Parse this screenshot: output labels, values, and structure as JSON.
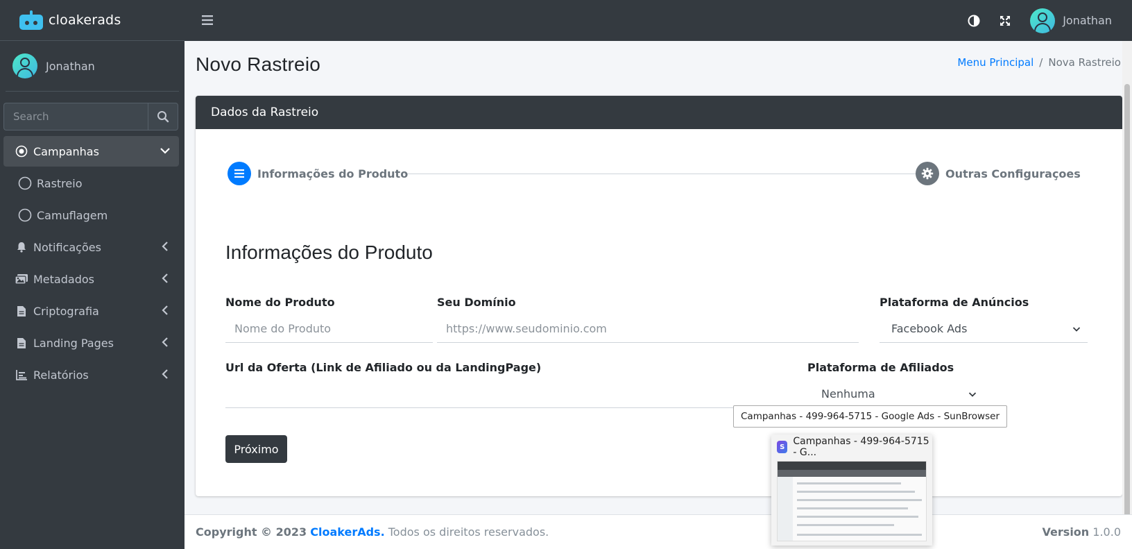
{
  "brand": {
    "name": "cloakerads"
  },
  "sidebar": {
    "user_name": "Jonathan",
    "search_placeholder": "Search",
    "items": [
      {
        "label": "Campanhas"
      },
      {
        "label": "Rastreio"
      },
      {
        "label": "Camuflagem"
      },
      {
        "label": "Notificações"
      },
      {
        "label": "Metadados"
      },
      {
        "label": "Criptografia"
      },
      {
        "label": "Landing Pages"
      },
      {
        "label": "Relatórios"
      }
    ]
  },
  "header": {
    "user_name": "Jonathan"
  },
  "page": {
    "title": "Novo Rastreio",
    "breadcrumb": {
      "home": "Menu Principal",
      "separator": "/",
      "current": "Nova Rastreio"
    }
  },
  "card": {
    "title": "Dados da Rastreio",
    "steps": [
      {
        "label": "Informações do Produto"
      },
      {
        "label": "Outras Configuraçoes"
      }
    ],
    "section_title": "Informações do Produto",
    "fields": {
      "product_name": {
        "label": "Nome do Produto",
        "placeholder": "Nome do Produto",
        "value": ""
      },
      "domain": {
        "label": "Seu Domínio",
        "placeholder": "https://www.seudominio.com",
        "value": ""
      },
      "ad_platform": {
        "label": "Plataforma de Anúncios",
        "value": "Facebook Ads"
      },
      "offer_url": {
        "label": "Url da Oferta (Link de Afiliado ou da LandingPage)",
        "value": ""
      },
      "affiliate_platform": {
        "label": "Plataforma de Afiliados",
        "value": "Nenhuma"
      }
    },
    "next_label": "Próximo"
  },
  "footer": {
    "copyright": "Copyright © 2023",
    "brand": "CloakerAds.",
    "rights": "Todos os direitos reservados.",
    "version_label": "Version",
    "version": "1.0.0"
  },
  "overlay": {
    "tooltip": "Campanhas - 499-964-5715 - Google Ads - SunBrowser",
    "preview_title": "Campanhas - 499-964-5715 - G..."
  },
  "colors": {
    "sidebar": "#343a40",
    "accent": "#007bff",
    "step_active": "#007bff",
    "step_inactive": "#6c757d"
  }
}
